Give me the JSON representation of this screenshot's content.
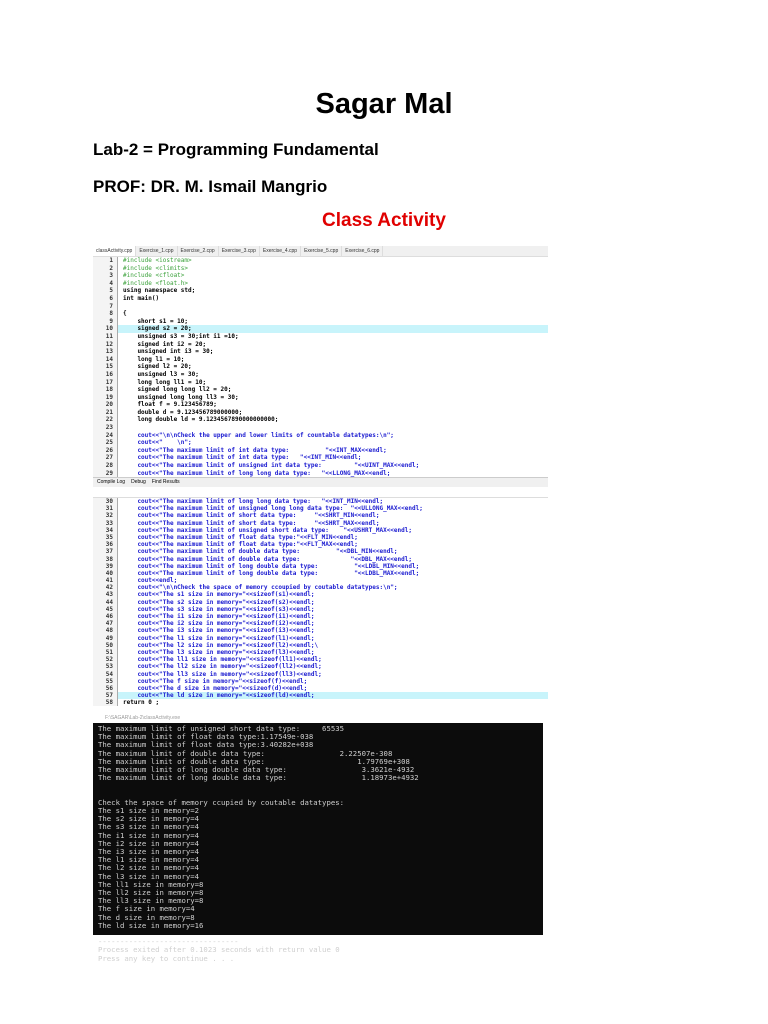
{
  "document": {
    "title": "Sagar Mal",
    "subtitle": "Lab-2 = Programming Fundamental",
    "professor": "PROF: DR. M. Ismail Mangrio",
    "section": "Class Activity"
  },
  "editor": {
    "tabs": [
      "classActivity.cpp",
      "Exercise_1.cpp",
      "Exercise_2.cpp",
      "Exercise_3.cpp",
      "Exercise_4.cpp",
      "Exercise_5.cpp",
      "Exercise_6.cpp"
    ],
    "bottom_tabs": [
      "Compile Log",
      "Debug",
      "Find Results"
    ],
    "lines_part1": [
      {
        "n": "1",
        "t": "#include <iostream>",
        "k": "pp"
      },
      {
        "n": "2",
        "t": "#include <climits>",
        "k": "pp"
      },
      {
        "n": "3",
        "t": "#include <cfloat>",
        "k": "pp"
      },
      {
        "n": "4",
        "t": "#include <float.h>",
        "k": "pp"
      },
      {
        "n": "5",
        "t": "using namespace std;",
        "k": ""
      },
      {
        "n": "6",
        "t": "int main()",
        "k": ""
      },
      {
        "n": "7",
        "t": "",
        "k": ""
      },
      {
        "n": "8",
        "t": "{",
        "k": ""
      },
      {
        "n": "9",
        "t": "    short s1 = 10;",
        "k": ""
      },
      {
        "n": "10",
        "t": "    signed s2 = 20;",
        "k": "hl"
      },
      {
        "n": "11",
        "t": "    unsigned s3 = 30;int i1 =10;",
        "k": ""
      },
      {
        "n": "12",
        "t": "    signed int i2 = 20;",
        "k": ""
      },
      {
        "n": "13",
        "t": "    unsigned int i3 = 30;",
        "k": ""
      },
      {
        "n": "14",
        "t": "    long l1 = 10;",
        "k": ""
      },
      {
        "n": "15",
        "t": "    signed l2 = 20;",
        "k": ""
      },
      {
        "n": "16",
        "t": "    unsigned l3 = 30;",
        "k": ""
      },
      {
        "n": "17",
        "t": "    long long ll1 = 10;",
        "k": ""
      },
      {
        "n": "18",
        "t": "    signed long long ll2 = 20;",
        "k": ""
      },
      {
        "n": "19",
        "t": "    unsigned long long ll3 = 30;",
        "k": ""
      },
      {
        "n": "20",
        "t": "    float f = 9.123456789;",
        "k": ""
      },
      {
        "n": "21",
        "t": "    double d = 9.123456789000000;",
        "k": ""
      },
      {
        "n": "22",
        "t": "    long double ld = 9.1234567890000000000;",
        "k": ""
      },
      {
        "n": "23",
        "t": "",
        "k": ""
      },
      {
        "n": "24",
        "t": "    cout<<\"\\n\\nCheck the upper and lower limits of countable datatypes:\\n\";",
        "k": "out"
      },
      {
        "n": "25",
        "t": "    cout<<\"    \\n\";",
        "k": "out"
      },
      {
        "n": "26",
        "t": "    cout<<\"The maximum limit of int data type:          \"<<INT_MAX<<endl;",
        "k": "out"
      },
      {
        "n": "27",
        "t": "    cout<<\"The maximum limit of int data type:   \"<<INT_MIN<<endl;",
        "k": "out"
      },
      {
        "n": "28",
        "t": "    cout<<\"The maximum limit of unsigned int data type:         \"<<UINT_MAX<<endl;",
        "k": "out"
      },
      {
        "n": "29",
        "t": "    cout<<\"The maximum limit of long long data type:   \"<<LLONG_MAX<<endl;",
        "k": "out"
      }
    ],
    "lines_part2": [
      {
        "n": "30",
        "t": "    cout<<\"The maximum limit of long long data type:   \"<<INT_MIN<<endl;",
        "k": "out"
      },
      {
        "n": "31",
        "t": "    cout<<\"The maximum limit of unsigned long long data type:  \"<<ULLONG_MAX<<endl;",
        "k": "out"
      },
      {
        "n": "32",
        "t": "    cout<<\"The maximum limit of short data type:     \"<<SHRT_MIN<<endl;",
        "k": "out"
      },
      {
        "n": "33",
        "t": "    cout<<\"The maximum limit of short data type:     \"<<SHRT_MAX<<endl;",
        "k": "out"
      },
      {
        "n": "34",
        "t": "    cout<<\"The maximum limit of unsigned short data type:    \"<<USHRT_MAX<<endl;",
        "k": "out"
      },
      {
        "n": "35",
        "t": "    cout<<\"The maximum limit of float data type:\"<<FLT_MIN<<endl;",
        "k": "out"
      },
      {
        "n": "36",
        "t": "    cout<<\"The maximum limit of float data type:\"<<FLT_MAX<<endl;",
        "k": "out"
      },
      {
        "n": "37",
        "t": "    cout<<\"The maximum limit of double data type:          \"<<DBL_MIN<<endl;",
        "k": "out"
      },
      {
        "n": "38",
        "t": "    cout<<\"The maximum limit of double data type:              \"<<DBL_MAX<<endl;",
        "k": "out"
      },
      {
        "n": "39",
        "t": "    cout<<\"The maximum limit of long double data type:          \"<<LDBL_MIN<<endl;",
        "k": "out"
      },
      {
        "n": "40",
        "t": "    cout<<\"The maximum limit of long double data type:          \"<<LDBL_MAX<<endl;",
        "k": "out"
      },
      {
        "n": "41",
        "t": "    cout<<endl;",
        "k": "out"
      },
      {
        "n": "42",
        "t": "    cout<<\"\\n\\nCheck the space of memory ccoupied by coutable datatypes:\\n\";",
        "k": "out"
      },
      {
        "n": "43",
        "t": "    cout<<\"The s1 size in memory=\"<<sizeof(s1)<<endl;",
        "k": "out"
      },
      {
        "n": "44",
        "t": "    cout<<\"The s2 size in memory=\"<<sizeof(s2)<<endl;",
        "k": "out"
      },
      {
        "n": "45",
        "t": "    cout<<\"The s3 size in memory=\"<<sizeof(s3)<<endl;",
        "k": "out"
      },
      {
        "n": "46",
        "t": "    cout<<\"The i1 size in memory=\"<<sizeof(i1)<<endl;",
        "k": "out"
      },
      {
        "n": "47",
        "t": "    cout<<\"The i2 size in memory=\"<<sizeof(i2)<<endl;",
        "k": "out"
      },
      {
        "n": "48",
        "t": "    cout<<\"The i3 size in memory=\"<<sizeof(i3)<<endl;",
        "k": "out"
      },
      {
        "n": "49",
        "t": "    cout<<\"The l1 size in memory=\"<<sizeof(l1)<<endl;",
        "k": "out"
      },
      {
        "n": "50",
        "t": "    cout<<\"The l2 size in memory=\"<<sizeof(l2)<<endl;\\",
        "k": "out"
      },
      {
        "n": "51",
        "t": "    cout<<\"The l3 size in memory=\"<<sizeof(l3)<<endl;",
        "k": "out"
      },
      {
        "n": "52",
        "t": "    cout<<\"The ll1 size in memory=\"<<sizeof(ll1)<<endl;",
        "k": "out"
      },
      {
        "n": "53",
        "t": "    cout<<\"The ll2 size in memory=\"<<sizeof(ll2)<<endl;",
        "k": "out"
      },
      {
        "n": "54",
        "t": "    cout<<\"The ll3 size in memory=\"<<sizeof(ll3)<<endl;",
        "k": "out"
      },
      {
        "n": "55",
        "t": "    cout<<\"The f size in memory=\"<<sizeof(f)<<endl;",
        "k": "out"
      },
      {
        "n": "56",
        "t": "    cout<<\"The d size in memory=\"<<sizeof(d)<<endl;",
        "k": "out"
      },
      {
        "n": "57",
        "t": "    cout<<\"The ld size in memory=\"<<sizeof(ld)<<endl;",
        "k": "out hl"
      },
      {
        "n": "58",
        "t": "return 0 ;",
        "k": ""
      }
    ]
  },
  "console": {
    "title": "F:\\SAGAR\\Lab-2\\classActivity.exe",
    "output": "The maximum limit of unsigned short data type:     65535\nThe maximum limit of float data type:1.17549e-038\nThe maximum limit of float data type:3.40282e+038\nThe maximum limit of double data type:                 2.22507e-308\nThe maximum limit of double data type:                     1.79769e+308\nThe maximum limit of long double data type:                 3.3621e-4932\nThe maximum limit of long double data type:                 1.18973e+4932\n\n\nCheck the space of memory ccupied by coutable datatypes:\nThe s1 size in memory=2\nThe s2 size in memory=4\nThe s3 size in memory=4\nThe i1 size in memory=4\nThe i2 size in memory=4\nThe i3 size in memory=4\nThe l1 size in memory=4\nThe l2 size in memory=4\nThe l3 size in memory=4\nThe ll1 size in memory=8\nThe ll2 size in memory=8\nThe ll3 size in memory=8\nThe f size in memory=4\nThe d size in memory=8\nThe ld size in memory=16\n\n--------------------------------\nProcess exited after 0.1023 seconds with return value 0\nPress any key to continue . . ."
  }
}
